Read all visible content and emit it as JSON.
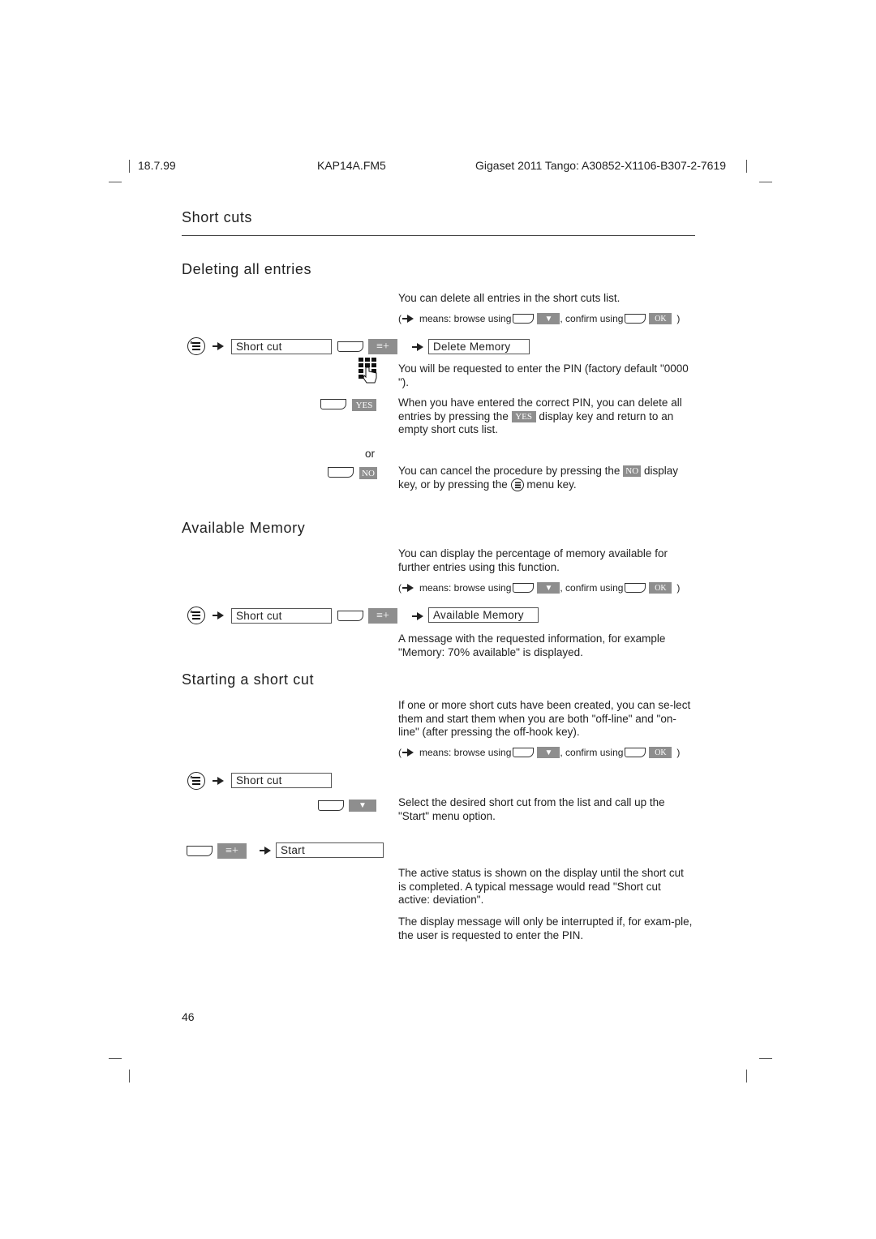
{
  "header": {
    "date": "18.7.99",
    "file": "KAP14A.FM5",
    "product": "Gigaset 2011 Tango: A30852-X1106-B307-2-7619"
  },
  "chapter_title": "Short cuts",
  "browse_hint": {
    "open": "(",
    "means": "means: browse using",
    "confirm": ", confirm using",
    "ok_label": "OK",
    "close": ")"
  },
  "keys": {
    "yes": "YES",
    "no": "NO",
    "menu_glyph": "≡+",
    "down_glyph": "▼"
  },
  "sections": {
    "deleting": {
      "title": "Deleting all entries",
      "intro": "You can delete all entries in the short cuts list.",
      "box_short_cut": "Short cut",
      "box_delete_memory": "Delete Memory",
      "pin_text": "You will be requested to enter the PIN (factory default \"0000 \").",
      "yes_text_1": "When you have entered the correct PIN, you can delete all entries by pressing the",
      "yes_text_2": "display key and return to an empty short cuts list.",
      "or": "or",
      "no_text_1": "You can cancel the procedure by pressing the",
      "no_text_2": "display key, or by pressing the",
      "no_text_3": "menu key."
    },
    "available": {
      "title": "Available Memory",
      "intro": "You can display the percentage of memory available for further entries using this function.",
      "box_short_cut": "Short cut",
      "box_available_memory": "Available Memory",
      "result_text": "A message with the requested information, for example \"Memory: 70% available\" is displayed."
    },
    "starting": {
      "title": "Starting a short cut",
      "intro": "If one or more short cuts have been created, you can se-lect them and start them when you are both \"off-line\" and \"on-line\" (after pressing the off-hook key).",
      "box_short_cut": "Short cut",
      "select_text": "Select the desired short cut from the list and call up the \"Start\" menu option.",
      "box_start": "Start",
      "active_text": "The active status is shown on the display until the short cut is completed. A typical message would read \"Short cut active: deviation\".",
      "interrupt_text": "The display message will only be interrupted if, for exam-ple, the user is requested to enter the PIN."
    }
  },
  "page_number": "46"
}
